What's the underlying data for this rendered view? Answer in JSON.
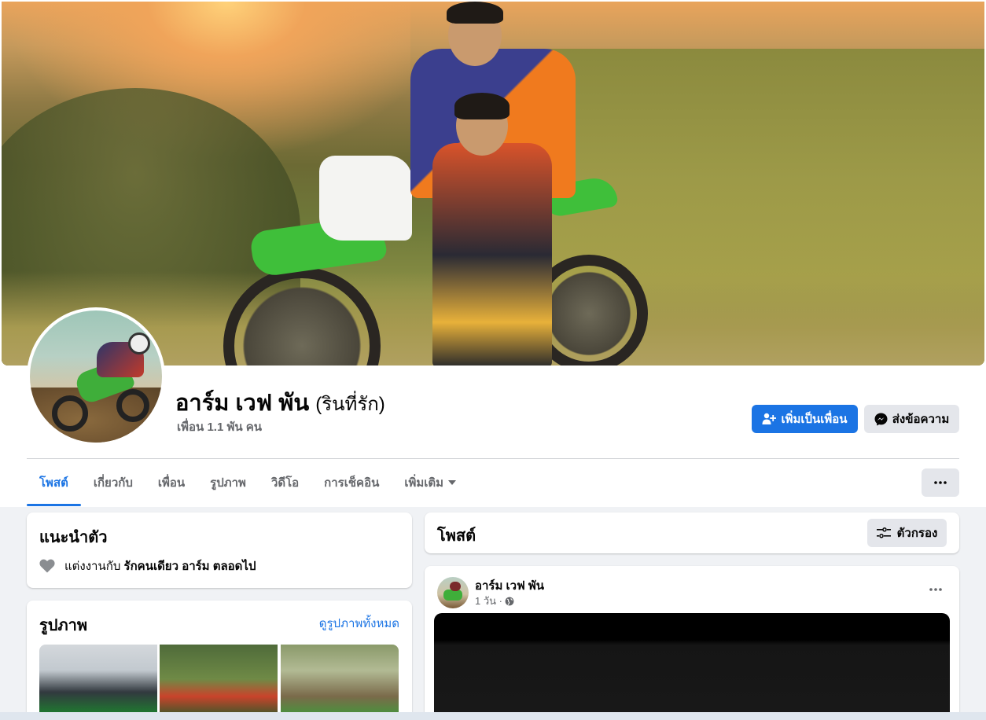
{
  "profile": {
    "name": "อาร์ม เวฟ พัน",
    "alternate_name": "(รินที่รัก)",
    "friends": "เพื่อน 1.1 พัน คน",
    "add_friend_label": "เพิ่มเป็นเพื่อน",
    "message_label": "ส่งข้อความ"
  },
  "tabs": [
    {
      "label": "โพสต์",
      "active": true
    },
    {
      "label": "เกี่ยวกับ"
    },
    {
      "label": "เพื่อน"
    },
    {
      "label": "รูปภาพ"
    },
    {
      "label": "วิดีโอ"
    },
    {
      "label": "การเช็คอิน"
    },
    {
      "label": "เพิ่มเติม"
    }
  ],
  "intro": {
    "title": "แนะนำตัว",
    "relationship_prefix": "แต่งงานกับ",
    "relationship_partner": "รักคนเดียว อาร์ม ตลอดไป"
  },
  "photos": {
    "title": "รูปภาพ",
    "see_all": "ดูรูปภาพทั้งหมด"
  },
  "posts_header": {
    "title": "โพสต์",
    "filter_label": "ตัวกรอง"
  },
  "post": {
    "author": "อาร์ม เวฟ พัน",
    "time": "1 วัน ·"
  },
  "colors": {
    "accent": "#1b74e4",
    "secondary_button": "#e4e6eb",
    "page_background": "#f0f2f5"
  },
  "icons": {
    "add_friend": "person-plus-icon",
    "messenger": "messenger-icon",
    "more": "ellipsis-icon",
    "dropdown": "caret-down-icon",
    "heart": "heart-icon",
    "filter": "filter-sliders-icon",
    "globe": "globe-icon"
  }
}
